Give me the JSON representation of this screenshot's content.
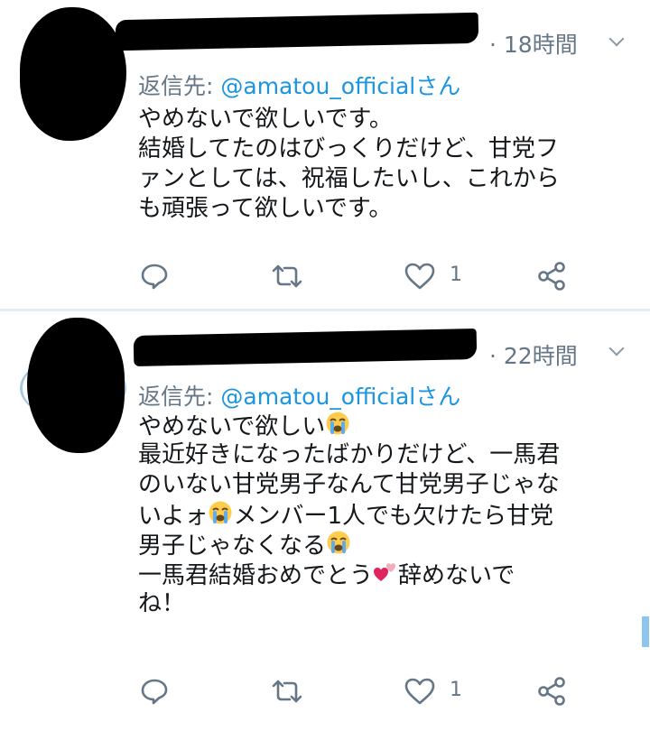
{
  "tweets": [
    {
      "time": "· 18時間",
      "reply_prefix": "返信先: ",
      "reply_handle": "@amatou_official",
      "reply_suffix": "さん",
      "lines": [
        "やめないで欲しいです。",
        "結婚してたのはびっくりだけど、甘党フ",
        "ァンとしては、祝福したいし、これから",
        "も頑張って欲しいです。"
      ],
      "likes": "1"
    },
    {
      "time": "· 22時間",
      "reply_prefix": "返信先: ",
      "reply_handle": "@amatou_official",
      "reply_suffix": "さん",
      "lines": [
        "やめないで欲しい",
        "最近好きになったばかりだけど、一馬君",
        "のいない甘党男子なんて甘党男子じゃな",
        "いよォ",
        "メンバー1人でも欠けたら甘党",
        "男子じゃなくなる",
        "一馬君結婚おめでとう",
        "辞めないで",
        "ね！"
      ],
      "likes": "1"
    }
  ],
  "icons": {
    "reply": "reply-icon",
    "retweet": "retweet-icon",
    "like": "heart-icon",
    "share": "share-icon",
    "crying": "crying-face-emoji",
    "hearts": "two-hearts-emoji"
  },
  "colors": {
    "link": "#1b95e0",
    "secondary": "#657786",
    "text": "#14171a",
    "separator": "#e6ecf0"
  }
}
